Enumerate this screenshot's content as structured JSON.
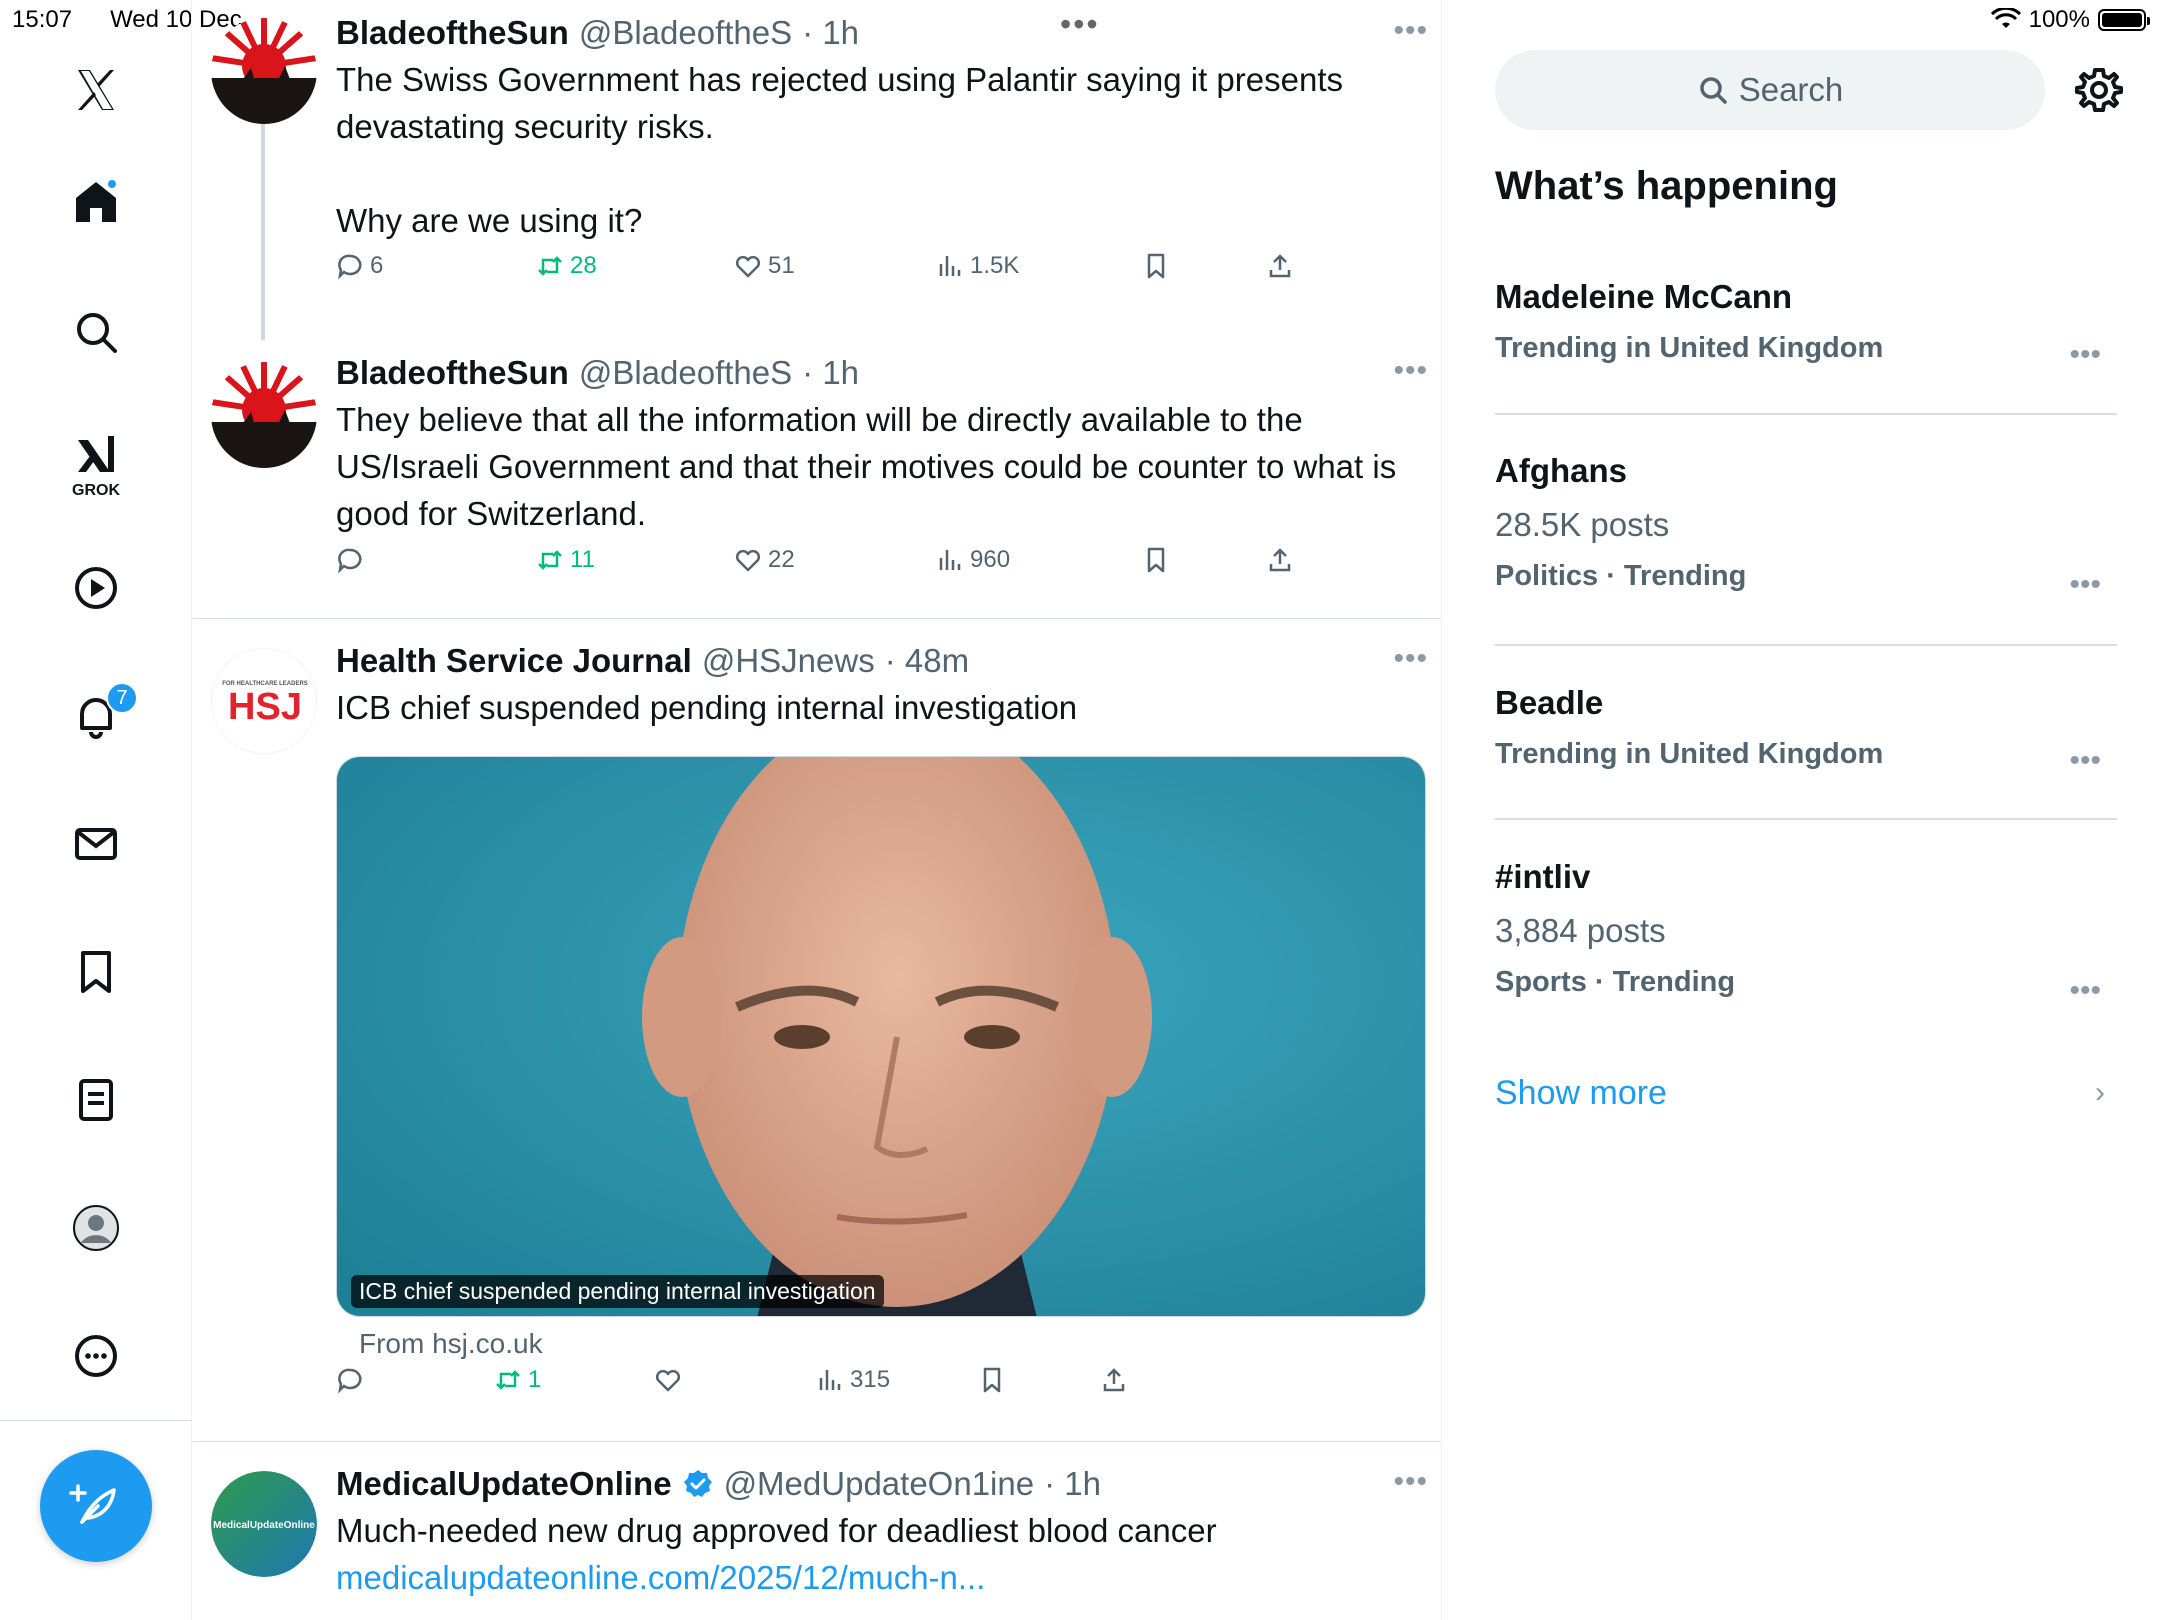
{
  "status_bar": {
    "time": "15:07",
    "date": "Wed 10 Dec",
    "battery": "100%"
  },
  "nav": {
    "grok_label": "GROK",
    "notifications_badge": "7"
  },
  "tweets": [
    {
      "name": "BladeoftheSun",
      "handle": "@BladeoftheS",
      "time": "· 1h",
      "text": "The Swiss Government has rejected using Palantir saying it presents devastating security risks.\n\nWhy are we using it?",
      "replies": "6",
      "reposts": "28",
      "likes": "51",
      "views": "1.5K"
    },
    {
      "name": "BladeoftheSun",
      "handle": "@BladeoftheS",
      "time": "· 1h",
      "text": "They believe that all the information will be directly available to the US/Israeli Government and that their motives could be counter to what is good for Switzerland.",
      "replies": "",
      "reposts": "11",
      "likes": "22",
      "views": "960"
    },
    {
      "name": "Health Service Journal",
      "handle": "@HSJnews",
      "time": "· 48m",
      "text": "ICB chief suspended pending internal investigation",
      "card_caption": "ICB chief suspended pending internal investigation",
      "card_from": "From hsj.co.uk",
      "replies": "",
      "reposts": "1",
      "likes": "",
      "views": "315"
    },
    {
      "name": "MedicalUpdateOnline",
      "handle": "@MedUpdateOn1ine",
      "time": "· 1h",
      "text": "Much-needed new drug approved for deadliest blood cancer",
      "link": "medicalupdateonline.com/2025/12/much-n..."
    }
  ],
  "sidebar": {
    "search_placeholder": "Search",
    "title": "What’s happening",
    "trends": [
      {
        "title": "Madeleine McCann",
        "posts": "",
        "meta": "Trending in United Kingdom"
      },
      {
        "title": "Afghans",
        "posts": "28.5K posts",
        "meta": "Politics · Trending"
      },
      {
        "title": "Beadle",
        "posts": "",
        "meta": "Trending in United Kingdom"
      },
      {
        "title": "#intliv",
        "posts": "3,884 posts",
        "meta": "Sports · Trending"
      }
    ],
    "show_more": "Show more"
  },
  "colors": {
    "accent": "#1d9bf0",
    "repost": "#00ba7c",
    "muted": "#536471"
  }
}
